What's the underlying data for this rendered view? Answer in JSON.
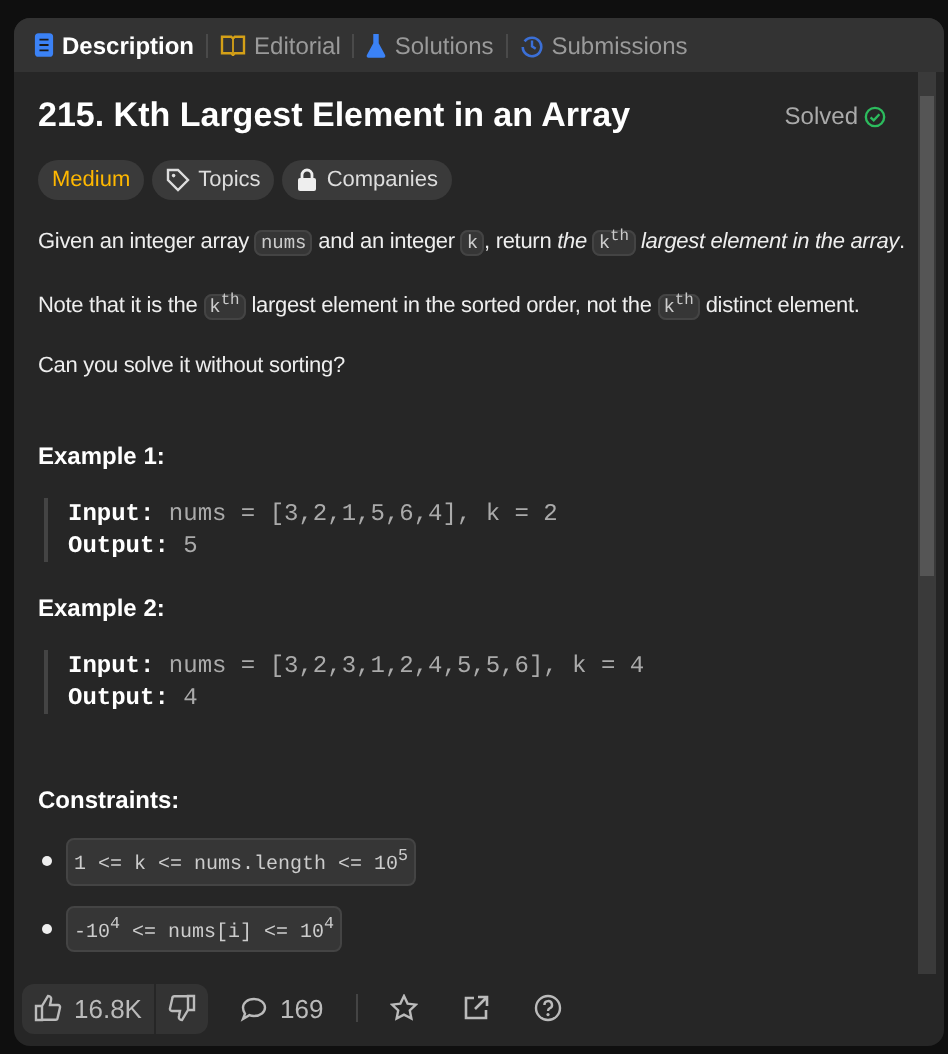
{
  "tabs": [
    {
      "label": "Description",
      "kind": "description",
      "selected": true
    },
    {
      "label": "Editorial",
      "kind": "book",
      "selected": false
    },
    {
      "label": "Solutions",
      "kind": "flask",
      "selected": false
    },
    {
      "label": "Submissions",
      "kind": "history",
      "selected": false
    }
  ],
  "title": "215. Kth Largest Element in an Array",
  "status": "Solved",
  "tags": [
    {
      "label": "Medium",
      "kind": "difficulty"
    },
    {
      "label": "Topics",
      "kind": "topics"
    },
    {
      "label": "Companies",
      "kind": "companies"
    }
  ],
  "paragraphs": [
    [
      {
        "kind": "text",
        "text": "Given an integer array "
      },
      {
        "kind": "code",
        "text": "nums"
      },
      {
        "kind": "text",
        "text": " and an integer "
      },
      {
        "kind": "code",
        "text": "k"
      },
      {
        "kind": "text",
        "text": ", return *the* "
      },
      {
        "kind": "code",
        "text": "k$^{th}$"
      },
      {
        "kind": "text",
        "text": " *largest element in the array*."
      }
    ],
    [
      {
        "kind": "text",
        "text": "Note that it is the "
      },
      {
        "kind": "code",
        "text": "k$^{th}$"
      },
      {
        "kind": "text",
        "text": " largest element in the sorted order, not the "
      },
      {
        "kind": "code",
        "text": "k$^{th}$"
      },
      {
        "kind": "text",
        "text": " distinct element."
      }
    ],
    [
      {
        "kind": "text",
        "text": "Can you solve it without sorting?"
      }
    ]
  ],
  "examples": [
    {
      "title": "Example 1:",
      "input_label": "Input:",
      "input": "nums = [3,2,1,5,6,4], k = 2",
      "output_label": "Output:",
      "output": "5"
    },
    {
      "title": "Example 2:",
      "input_label": "Input:",
      "input": "nums = [3,2,3,1,2,4,5,5,6], k = 4",
      "output_label": "Output:",
      "output": "4"
    }
  ],
  "constraints_title": "Constraints:",
  "constraints": [
    "1 <= k <= nums.length <= 10$^{5}$",
    "-10$^{4}$ <= nums[i] <= 10$^{4}$"
  ],
  "footer": {
    "likes": "16.8K",
    "comments": "169"
  }
}
